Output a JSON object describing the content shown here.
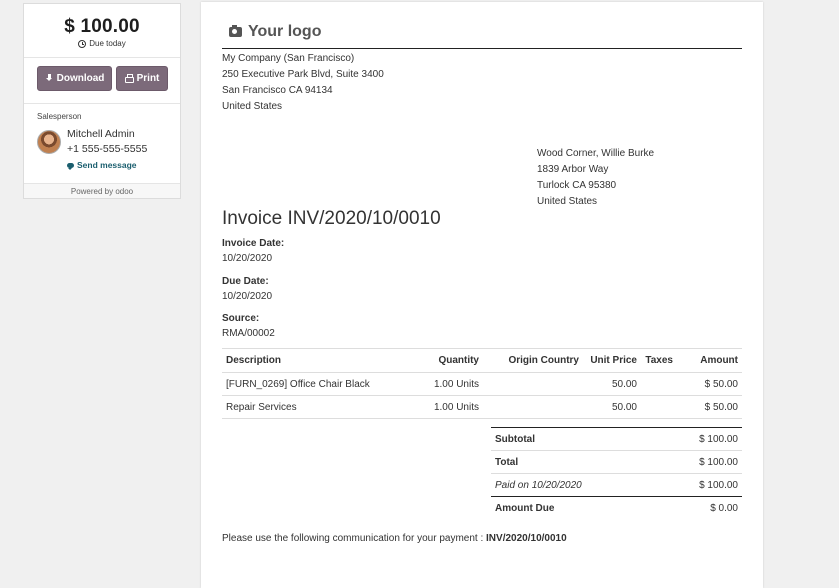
{
  "sidebar": {
    "amount": "$ 100.00",
    "due_label": "Due today",
    "download_label": "Download",
    "print_label": "Print",
    "salesperson_label": "Salesperson",
    "salesperson_name": "Mitchell Admin",
    "salesperson_phone": "+1 555-555-5555",
    "send_message_label": "Send message",
    "powered_by": "Powered by odoo"
  },
  "invoice": {
    "logo_text": "Your logo",
    "company_lines": [
      "My Company (San Francisco)",
      "250 Executive Park Blvd, Suite 3400",
      "San Francisco CA 94134",
      "United States"
    ],
    "partner_lines": [
      "Wood Corner, Willie Burke",
      "1839 Arbor Way",
      "Turlock CA 95380",
      "United States"
    ],
    "title": "Invoice INV/2020/10/0010",
    "invoice_date_label": "Invoice Date:",
    "invoice_date": "10/20/2020",
    "due_date_label": "Due Date:",
    "due_date": "10/20/2020",
    "source_label": "Source:",
    "source": "RMA/00002",
    "columns": [
      "Description",
      "Quantity",
      "Origin Country",
      "Unit Price",
      "Taxes",
      "Amount"
    ],
    "lines": [
      {
        "description": "[FURN_0269] Office Chair Black",
        "quantity": "1.00 Units",
        "origin": "",
        "unit_price": "50.00",
        "taxes": "",
        "amount": "$ 50.00"
      },
      {
        "description": "Repair Services",
        "quantity": "1.00 Units",
        "origin": "",
        "unit_price": "50.00",
        "taxes": "",
        "amount": "$ 50.00"
      }
    ],
    "subtotal_label": "Subtotal",
    "subtotal": "$ 100.00",
    "total_label": "Total",
    "total": "$ 100.00",
    "paid_label": "Paid on 10/20/2020",
    "paid_amount": "$ 100.00",
    "amount_due_label": "Amount Due",
    "amount_due": "$ 0.00",
    "communication_text": "Please use the following communication for your payment : ",
    "communication_ref": "INV/2020/10/0010"
  },
  "colors": {
    "button_bg": "#7c6a7a",
    "link": "#1a5e6e",
    "page_bg": "#f0f0f0"
  }
}
